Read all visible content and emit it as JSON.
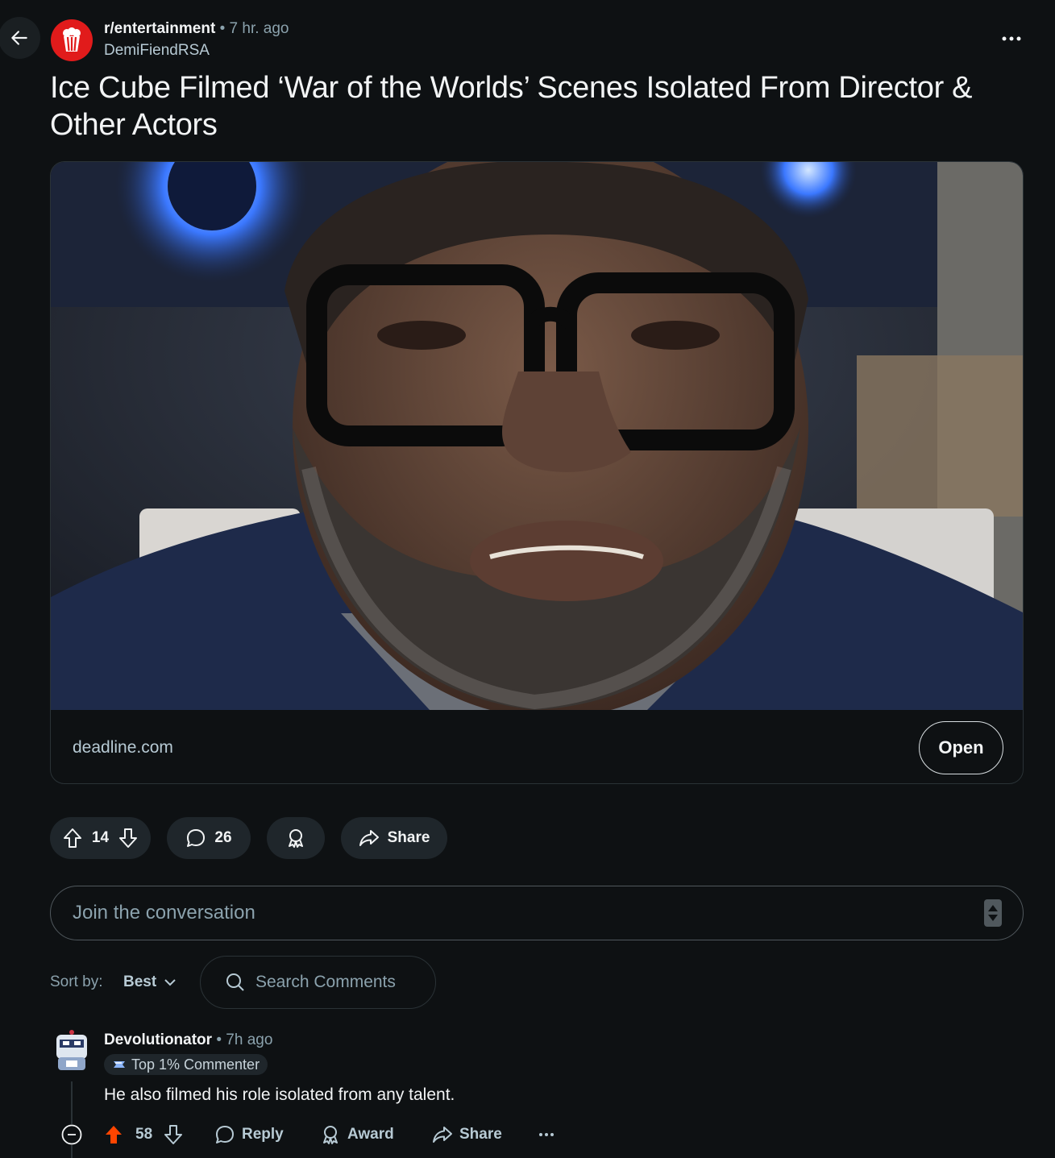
{
  "header": {
    "back_icon": "arrow-left-icon",
    "subreddit": "r/entertainment",
    "separator": "•",
    "time_ago": "7 hr. ago",
    "author": "DemiFiendRSA",
    "more_icon": "ellipsis-icon"
  },
  "post": {
    "title": "Ice Cube Filmed ‘War of the Worlds’ Scenes Isolated From Director & Other Actors",
    "link_domain": "deadline.com",
    "open_label": "Open"
  },
  "actions": {
    "vote_count": "14",
    "comment_count": "26",
    "share_label": "Share"
  },
  "composer": {
    "placeholder": "Join the conversation"
  },
  "sort": {
    "label": "Sort by:",
    "value": "Best",
    "search_placeholder": "Search Comments"
  },
  "comment": {
    "author": "Devolutionator",
    "separator": "•",
    "time_ago": "7h ago",
    "flair": "Top 1% Commenter",
    "body": "He also filmed his role isolated from any talent.",
    "vote_count": "58",
    "reply_label": "Reply",
    "award_label": "Award",
    "share_label": "Share"
  },
  "colors": {
    "background": "#0e1113",
    "pill": "#1f262b",
    "upvote_active": "#ff4500",
    "subreddit_avatar": "#e11b1b"
  }
}
